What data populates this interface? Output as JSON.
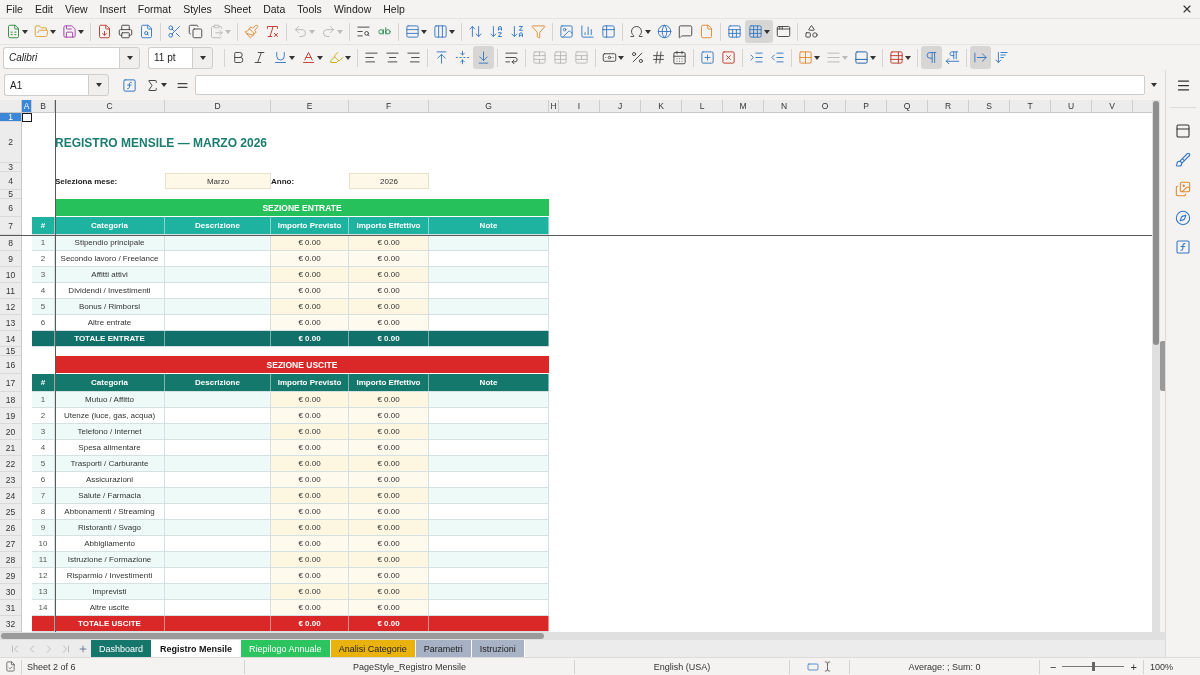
{
  "menu_bar": [
    "File",
    "Edit",
    "View",
    "Insert",
    "Format",
    "Styles",
    "Sheet",
    "Data",
    "Tools",
    "Window",
    "Help"
  ],
  "standard_toolbar": [
    {
      "pressed": false,
      "disabled": false
    },
    {
      "pressed": false,
      "disabled": false
    },
    {
      "pressed": false,
      "disabled": false
    },
    {
      "pressed": false,
      "disabled": false
    },
    {
      "pressed": false,
      "disabled": false
    },
    {
      "pressed": false,
      "disabled": false
    },
    {
      "pressed": false,
      "disabled": false
    },
    {
      "pressed": false,
      "disabled": false
    },
    {
      "pressed": false,
      "disabled": true
    },
    {
      "pressed": false,
      "disabled": false
    },
    {
      "pressed": false,
      "disabled": false
    },
    {
      "pressed": false,
      "disabled": true
    },
    {
      "pressed": false,
      "disabled": true
    },
    {
      "pressed": false,
      "disabled": false
    },
    {
      "pressed": false,
      "disabled": false
    },
    {
      "pressed": false,
      "disabled": false
    },
    {
      "pressed": false,
      "disabled": false
    },
    {
      "pressed": false,
      "disabled": false
    },
    {
      "pressed": false,
      "disabled": false
    },
    {
      "pressed": false,
      "disabled": false
    },
    {
      "pressed": false,
      "disabled": false
    },
    {
      "pressed": false,
      "disabled": false
    },
    {
      "pressed": false,
      "disabled": false
    },
    {
      "pressed": false,
      "disabled": false
    },
    {
      "pressed": false,
      "disabled": false
    },
    {
      "pressed": false,
      "disabled": false
    },
    {
      "pressed": false,
      "disabled": false
    },
    {
      "pressed": false,
      "disabled": false
    },
    {
      "pressed": false,
      "disabled": false
    },
    {
      "pressed": true,
      "disabled": false
    },
    {
      "pressed": false,
      "disabled": false
    },
    {
      "pressed": false,
      "disabled": false
    }
  ],
  "formatting_toolbar": {
    "font_name": "Calibri",
    "font_size": "11 pt",
    "buttons": [
      {
        "pressed": false,
        "disabled": false
      },
      {
        "pressed": false,
        "disabled": false
      },
      {
        "pressed": false,
        "disabled": false
      },
      {
        "pressed": false,
        "disabled": false
      },
      {
        "pressed": false,
        "disabled": false
      },
      {
        "pressed": false,
        "disabled": false
      },
      {
        "pressed": false,
        "disabled": false
      },
      {
        "pressed": false,
        "disabled": false
      },
      {
        "pressed": false,
        "disabled": false
      },
      {
        "pressed": false,
        "disabled": false
      },
      {
        "pressed": true,
        "disabled": false
      },
      {
        "pressed": false,
        "disabled": false
      },
      {
        "pressed": false,
        "disabled": true
      },
      {
        "pressed": false,
        "disabled": true
      },
      {
        "pressed": false,
        "disabled": true
      },
      {
        "pressed": false,
        "disabled": false
      },
      {
        "pressed": false,
        "disabled": false
      },
      {
        "pressed": false,
        "disabled": false
      },
      {
        "pressed": false,
        "disabled": false
      },
      {
        "pressed": false,
        "disabled": false
      },
      {
        "pressed": false,
        "disabled": false
      },
      {
        "pressed": false,
        "disabled": false
      },
      {
        "pressed": false,
        "disabled": false
      },
      {
        "pressed": false,
        "disabled": false
      },
      {
        "pressed": false,
        "disabled": true
      },
      {
        "pressed": false,
        "disabled": false
      },
      {
        "pressed": false,
        "disabled": false
      },
      {
        "pressed": true,
        "disabled": false
      },
      {
        "pressed": false,
        "disabled": false
      },
      {
        "pressed": true,
        "disabled": false
      },
      {
        "pressed": false,
        "disabled": false
      }
    ]
  },
  "formula_bar": {
    "name_box": "A1"
  },
  "columns": [
    {
      "label": "A",
      "selected": true
    },
    {
      "label": "B",
      "selected": false
    },
    {
      "label": "C",
      "selected": false
    },
    {
      "label": "D",
      "selected": false
    },
    {
      "label": "E",
      "selected": false
    },
    {
      "label": "F",
      "selected": false
    },
    {
      "label": "G",
      "selected": false
    },
    {
      "label": "H",
      "selected": false
    },
    {
      "label": "I",
      "selected": false
    },
    {
      "label": "J",
      "selected": false
    },
    {
      "label": "K",
      "selected": false
    },
    {
      "label": "L",
      "selected": false
    },
    {
      "label": "M",
      "selected": false
    },
    {
      "label": "N",
      "selected": false
    },
    {
      "label": "O",
      "selected": false
    },
    {
      "label": "P",
      "selected": false
    },
    {
      "label": "Q",
      "selected": false
    },
    {
      "label": "R",
      "selected": false
    },
    {
      "label": "S",
      "selected": false
    },
    {
      "label": "T",
      "selected": false
    },
    {
      "label": "U",
      "selected": false
    },
    {
      "label": "V",
      "selected": false
    }
  ],
  "rows": [
    {
      "number": "1",
      "selected": true,
      "kind": "blank"
    },
    {
      "number": "2",
      "selected": false,
      "kind": "title",
      "text": "REGISTRO MENSILE — MARZO 2026"
    },
    {
      "number": "3",
      "selected": false,
      "kind": "blank"
    },
    {
      "number": "4",
      "selected": false,
      "kind": "inputs",
      "fields": [
        {
          "label": "Seleziona mese:",
          "value": "Marzo"
        },
        {
          "label": "Anno:",
          "value": "2026"
        }
      ]
    },
    {
      "number": "5",
      "selected": false,
      "kind": "blank"
    },
    {
      "number": "6",
      "selected": false,
      "kind": "section",
      "text": "SEZIONE ENTRATE",
      "color": "#26c15b"
    },
    {
      "number": "7",
      "selected": false,
      "kind": "header",
      "color": "#1db3a0",
      "cells": [
        "#",
        "Categoria",
        "Descrizione",
        "Importo Previsto",
        "Importo Effettivo",
        "Note"
      ]
    },
    {
      "number": "8",
      "selected": false,
      "kind": "entry",
      "index": "1",
      "category": "Stipendio principale",
      "planned": "€ 0.00",
      "actual": "€ 0.00"
    },
    {
      "number": "9",
      "selected": false,
      "kind": "entry",
      "index": "2",
      "category": "Secondo lavoro / Freelance",
      "planned": "€ 0.00",
      "actual": "€ 0.00"
    },
    {
      "number": "10",
      "selected": false,
      "kind": "entry",
      "index": "3",
      "category": "Affitti attivi",
      "planned": "€ 0.00",
      "actual": "€ 0.00"
    },
    {
      "number": "11",
      "selected": false,
      "kind": "entry",
      "index": "4",
      "category": "Dividendi / Investimenti",
      "planned": "€ 0.00",
      "actual": "€ 0.00"
    },
    {
      "number": "12",
      "selected": false,
      "kind": "entry",
      "index": "5",
      "category": "Bonus / Rimborsi",
      "planned": "€ 0.00",
      "actual": "€ 0.00"
    },
    {
      "number": "13",
      "selected": false,
      "kind": "entry",
      "index": "6",
      "category": "Altre entrate",
      "planned": "€ 0.00",
      "actual": "€ 0.00"
    },
    {
      "number": "14",
      "selected": false,
      "kind": "total",
      "color": "#12706a",
      "label": "TOTALE ENTRATE",
      "planned": "€ 0.00",
      "actual": "€ 0.00"
    },
    {
      "number": "15",
      "selected": false,
      "kind": "blank"
    },
    {
      "number": "16",
      "selected": false,
      "kind": "section",
      "text": "SEZIONE USCITE",
      "color": "#da2727"
    },
    {
      "number": "17",
      "selected": false,
      "kind": "header",
      "color": "#15786d",
      "cells": [
        "#",
        "Categoria",
        "Descrizione",
        "Importo Previsto",
        "Importo Effettivo",
        "Note"
      ]
    },
    {
      "number": "18",
      "selected": false,
      "kind": "entry",
      "index": "1",
      "category": "Mutuo / Affitto",
      "planned": "€ 0.00",
      "actual": "€ 0.00"
    },
    {
      "number": "19",
      "selected": false,
      "kind": "entry",
      "index": "2",
      "category": "Utenze (luce, gas, acqua)",
      "planned": "€ 0.00",
      "actual": "€ 0.00"
    },
    {
      "number": "20",
      "selected": false,
      "kind": "entry",
      "index": "3",
      "category": "Telefono / Internet",
      "planned": "€ 0.00",
      "actual": "€ 0.00"
    },
    {
      "number": "21",
      "selected": false,
      "kind": "entry",
      "index": "4",
      "category": "Spesa alimentare",
      "planned": "€ 0.00",
      "actual": "€ 0.00"
    },
    {
      "number": "22",
      "selected": false,
      "kind": "entry",
      "index": "5",
      "category": "Trasporti / Carburante",
      "planned": "€ 0.00",
      "actual": "€ 0.00"
    },
    {
      "number": "23",
      "selected": false,
      "kind": "entry",
      "index": "6",
      "category": "Assicurazioni",
      "planned": "€ 0.00",
      "actual": "€ 0.00"
    },
    {
      "number": "24",
      "selected": false,
      "kind": "entry",
      "index": "7",
      "category": "Salute / Farmacia",
      "planned": "€ 0.00",
      "actual": "€ 0.00"
    },
    {
      "number": "25",
      "selected": false,
      "kind": "entry",
      "index": "8",
      "category": "Abbonamenti / Streaming",
      "planned": "€ 0.00",
      "actual": "€ 0.00"
    },
    {
      "number": "26",
      "selected": false,
      "kind": "entry",
      "index": "9",
      "category": "Ristoranti / Svago",
      "planned": "€ 0.00",
      "actual": "€ 0.00"
    },
    {
      "number": "27",
      "selected": false,
      "kind": "entry",
      "index": "10",
      "category": "Abbigliamento",
      "planned": "€ 0.00",
      "actual": "€ 0.00"
    },
    {
      "number": "28",
      "selected": false,
      "kind": "entry",
      "index": "11",
      "category": "Istruzione / Formazione",
      "planned": "€ 0.00",
      "actual": "€ 0.00"
    },
    {
      "number": "29",
      "selected": false,
      "kind": "entry",
      "index": "12",
      "category": "Risparmio / Investimenti",
      "planned": "€ 0.00",
      "actual": "€ 0.00"
    },
    {
      "number": "30",
      "selected": false,
      "kind": "entry",
      "index": "13",
      "category": "Imprevisti",
      "planned": "€ 0.00",
      "actual": "€ 0.00"
    },
    {
      "number": "31",
      "selected": false,
      "kind": "entry",
      "index": "14",
      "category": "Altre uscite",
      "planned": "€ 0.00",
      "actual": "€ 0.00"
    },
    {
      "number": "32",
      "selected": false,
      "kind": "total",
      "color": "#da2727",
      "label": "TOTALE USCITE",
      "planned": "€ 0.00",
      "actual": "€ 0.00"
    }
  ],
  "sheet_navigation": {
    "disabled": true
  },
  "sheet_tabs": [
    {
      "label": "Dashboard",
      "selected": false,
      "color": "#17766b"
    },
    {
      "label": "Registro Mensile",
      "selected": true
    },
    {
      "label": "Riepilogo Annuale",
      "selected": false,
      "color": "#2cc45f"
    },
    {
      "label": "Analisi Categorie",
      "selected": false,
      "color": "#e9b20c"
    },
    {
      "label": "Parametri",
      "selected": false,
      "color": "#a6b1c5"
    },
    {
      "label": "Istruzioni",
      "selected": false,
      "color": "#a9b3c6"
    }
  ],
  "status_bar": {
    "sheet": "Sheet 2 of 6",
    "page_style": "PageStyle_Registro Mensile",
    "language": "English (USA)",
    "summary": "Average: ; Sum: 0",
    "zoom": {
      "minus": "−",
      "plus": "+",
      "level": 0.5,
      "reading": "100%"
    }
  }
}
